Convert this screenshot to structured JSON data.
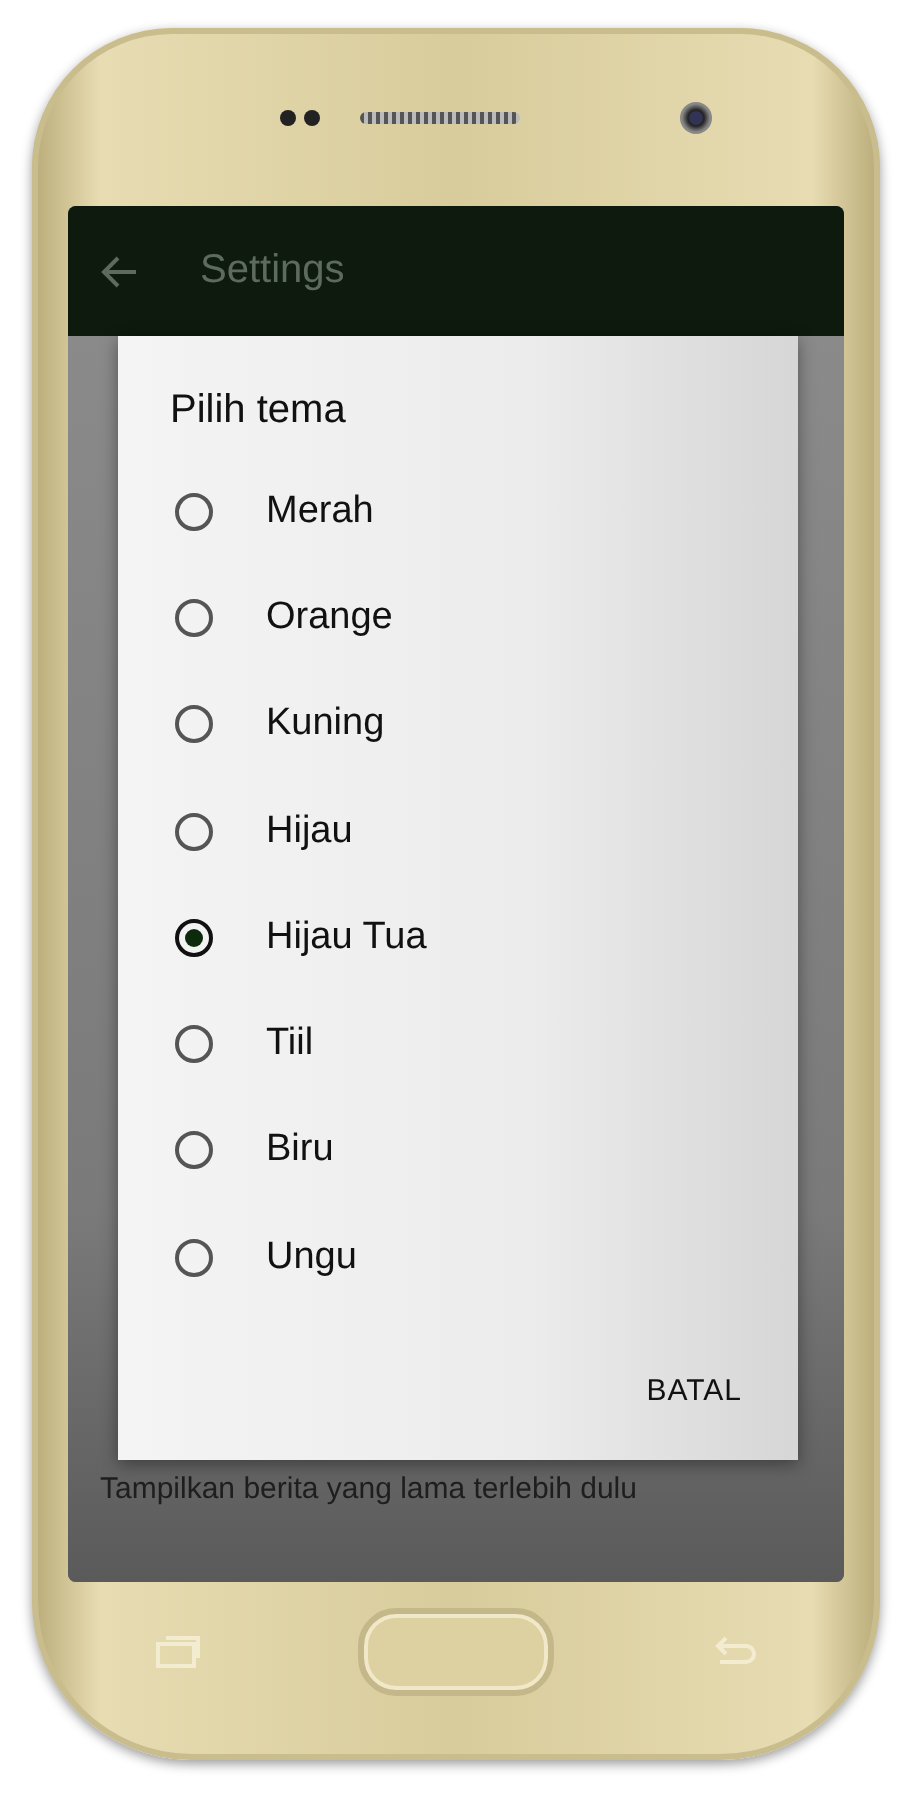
{
  "toolbar": {
    "title": "Settings"
  },
  "background_summary": "Tampilkan berita yang lama terlebih dulu",
  "dialog": {
    "title": "Pilih tema",
    "options": [
      {
        "label": "Merah",
        "selected": false
      },
      {
        "label": "Orange",
        "selected": false
      },
      {
        "label": "Kuning",
        "selected": false
      },
      {
        "label": "Hijau",
        "selected": false
      },
      {
        "label": "Hijau Tua",
        "selected": true
      },
      {
        "label": "Tiil",
        "selected": false
      },
      {
        "label": "Biru",
        "selected": false
      },
      {
        "label": "Ungu",
        "selected": false
      }
    ],
    "buttons": [
      "BATAL"
    ]
  }
}
